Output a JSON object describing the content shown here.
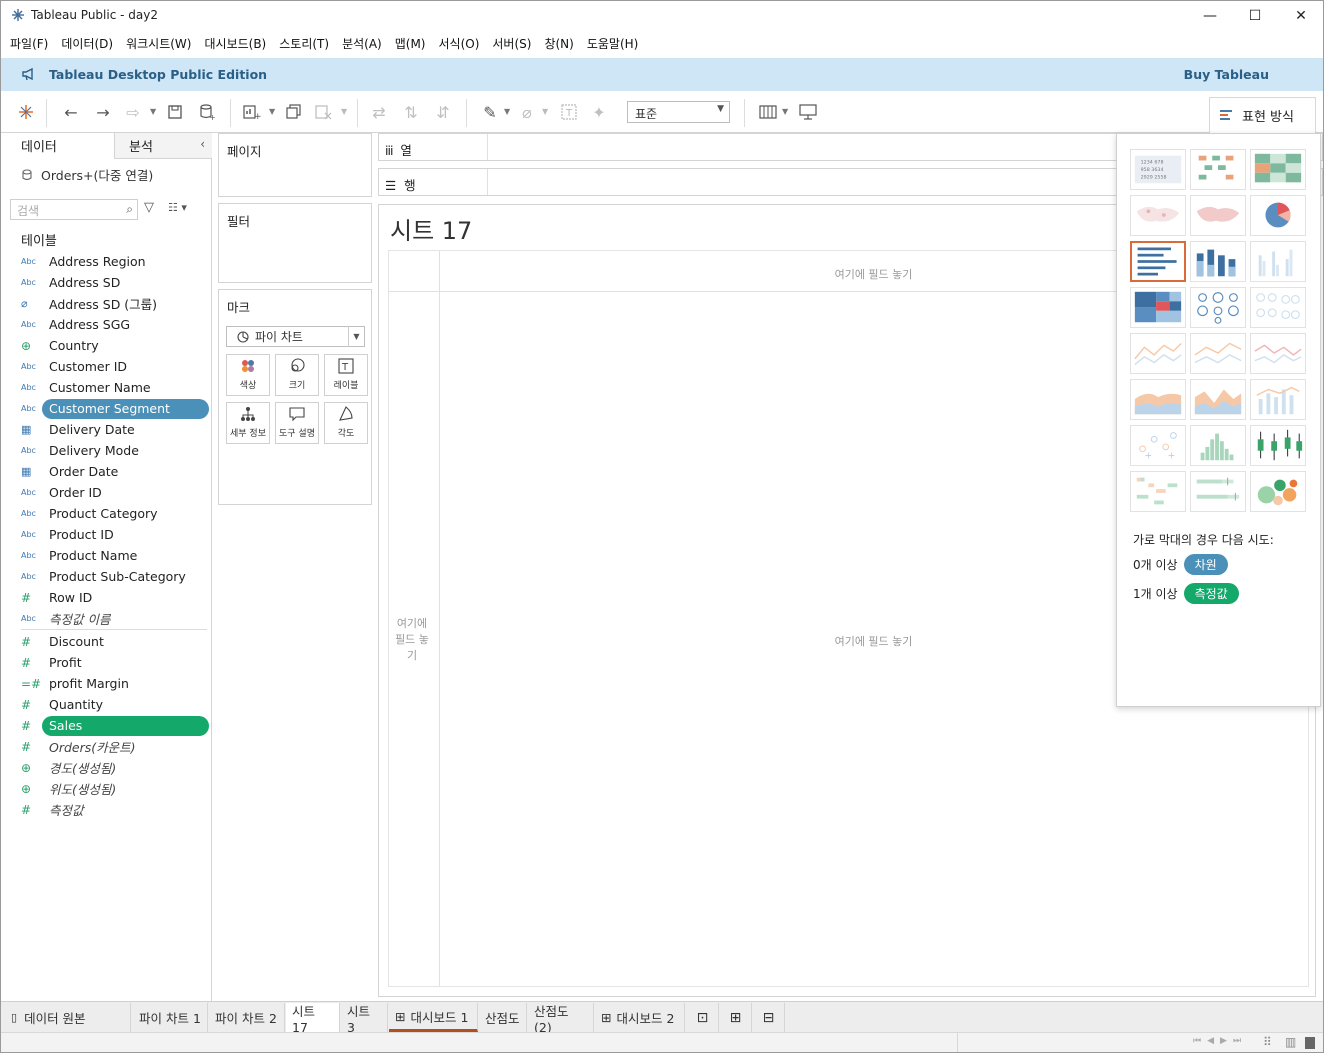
{
  "window": {
    "title": "Tableau Public - day2",
    "controls": {
      "minimize": "—",
      "maximize": "☐",
      "close": "✕"
    }
  },
  "menu": [
    "파일(F)",
    "데이터(D)",
    "워크시트(W)",
    "대시보드(B)",
    "스토리(T)",
    "분석(A)",
    "맵(M)",
    "서식(O)",
    "서버(S)",
    "창(N)",
    "도움말(H)"
  ],
  "banner": {
    "title": "Tableau Desktop Public Edition",
    "buy": "Buy Tableau"
  },
  "toolbar": {
    "fit_value": "표준",
    "show_me_label": "표현 방식"
  },
  "data_pane": {
    "tab_data": "데이터",
    "tab_analytics": "분석",
    "datasource": "Orders+(다중 연결)",
    "search_placeholder": "검색",
    "tables_heading": "테이블",
    "dimensions": [
      {
        "type": "Abc",
        "name": "Address Region"
      },
      {
        "type": "Abc",
        "name": "Address SD"
      },
      {
        "type": "clip",
        "name": "Address SD (그룹)"
      },
      {
        "type": "Abc",
        "name": "Address SGG"
      },
      {
        "type": "globe",
        "name": "Country"
      },
      {
        "type": "Abc",
        "name": "Customer ID"
      },
      {
        "type": "Abc",
        "name": "Customer Name"
      },
      {
        "type": "Abc",
        "name": "Customer Segment",
        "selected": "blue"
      },
      {
        "type": "date",
        "name": "Delivery Date"
      },
      {
        "type": "Abc",
        "name": "Delivery Mode"
      },
      {
        "type": "date",
        "name": "Order Date"
      },
      {
        "type": "Abc",
        "name": "Order ID"
      },
      {
        "type": "Abc",
        "name": "Product Category"
      },
      {
        "type": "Abc",
        "name": "Product ID"
      },
      {
        "type": "Abc",
        "name": "Product Name"
      },
      {
        "type": "Abc",
        "name": "Product Sub-Category"
      },
      {
        "type": "#",
        "name": "Row ID"
      },
      {
        "type": "Abc",
        "name": "측정값 이름",
        "italic": true
      }
    ],
    "measures": [
      {
        "type": "#",
        "name": "Discount"
      },
      {
        "type": "#",
        "name": "Profit"
      },
      {
        "type": "=#",
        "name": "profit Margin"
      },
      {
        "type": "#",
        "name": "Quantity"
      },
      {
        "type": "#",
        "name": "Sales",
        "selected": "green"
      },
      {
        "type": "#",
        "name": "Orders(카운트)",
        "italic": true
      },
      {
        "type": "globe",
        "name": "경도(생성됨)",
        "italic": true
      },
      {
        "type": "globe",
        "name": "위도(생성됨)",
        "italic": true
      },
      {
        "type": "#",
        "name": "측정값",
        "italic": true
      }
    ]
  },
  "cards": {
    "pages": "페이지",
    "filters": "필터",
    "marks": "마크",
    "mark_type": "파이 차트",
    "mark_buttons": [
      {
        "label": "색상",
        "icon": "color-icon"
      },
      {
        "label": "크기",
        "icon": "size-icon"
      },
      {
        "label": "레이블",
        "icon": "label-icon"
      },
      {
        "label": "세부 정보",
        "icon": "detail-icon"
      },
      {
        "label": "도구 설명",
        "icon": "tooltip-icon"
      },
      {
        "label": "각도",
        "icon": "angle-icon"
      }
    ]
  },
  "shelves": {
    "columns": "열",
    "rows": "행"
  },
  "view": {
    "sheet_title": "시트 17",
    "drop_top": "여기에 필드 놓기",
    "drop_left": "여기에 필드 놓기",
    "drop_center": "여기에 필드 놓기"
  },
  "show_me": {
    "hint": "가로 막대의 경우 다음 시도:",
    "line1_prefix": "0개 이상",
    "line1_pill": "차원",
    "line2_prefix": "1개 이상",
    "line2_pill": "측정값",
    "colors": {
      "dimension": "#4a90b8",
      "measure": "#14a86b",
      "selected_border": "#d96b3a"
    }
  },
  "sheet_tabs": [
    {
      "label": "데이터 원본",
      "icon": "datasource-icon"
    },
    {
      "label": "파이 차트 1"
    },
    {
      "label": "파이 차트 2"
    },
    {
      "label": "시트 17",
      "active": true
    },
    {
      "label": "시트 3"
    },
    {
      "label": "대시보드 1",
      "icon": "dashboard-icon",
      "dash": true
    },
    {
      "label": "산점도"
    },
    {
      "label": "산점도 (2)"
    },
    {
      "label": "대시보드 2",
      "icon": "dashboard-icon"
    }
  ]
}
